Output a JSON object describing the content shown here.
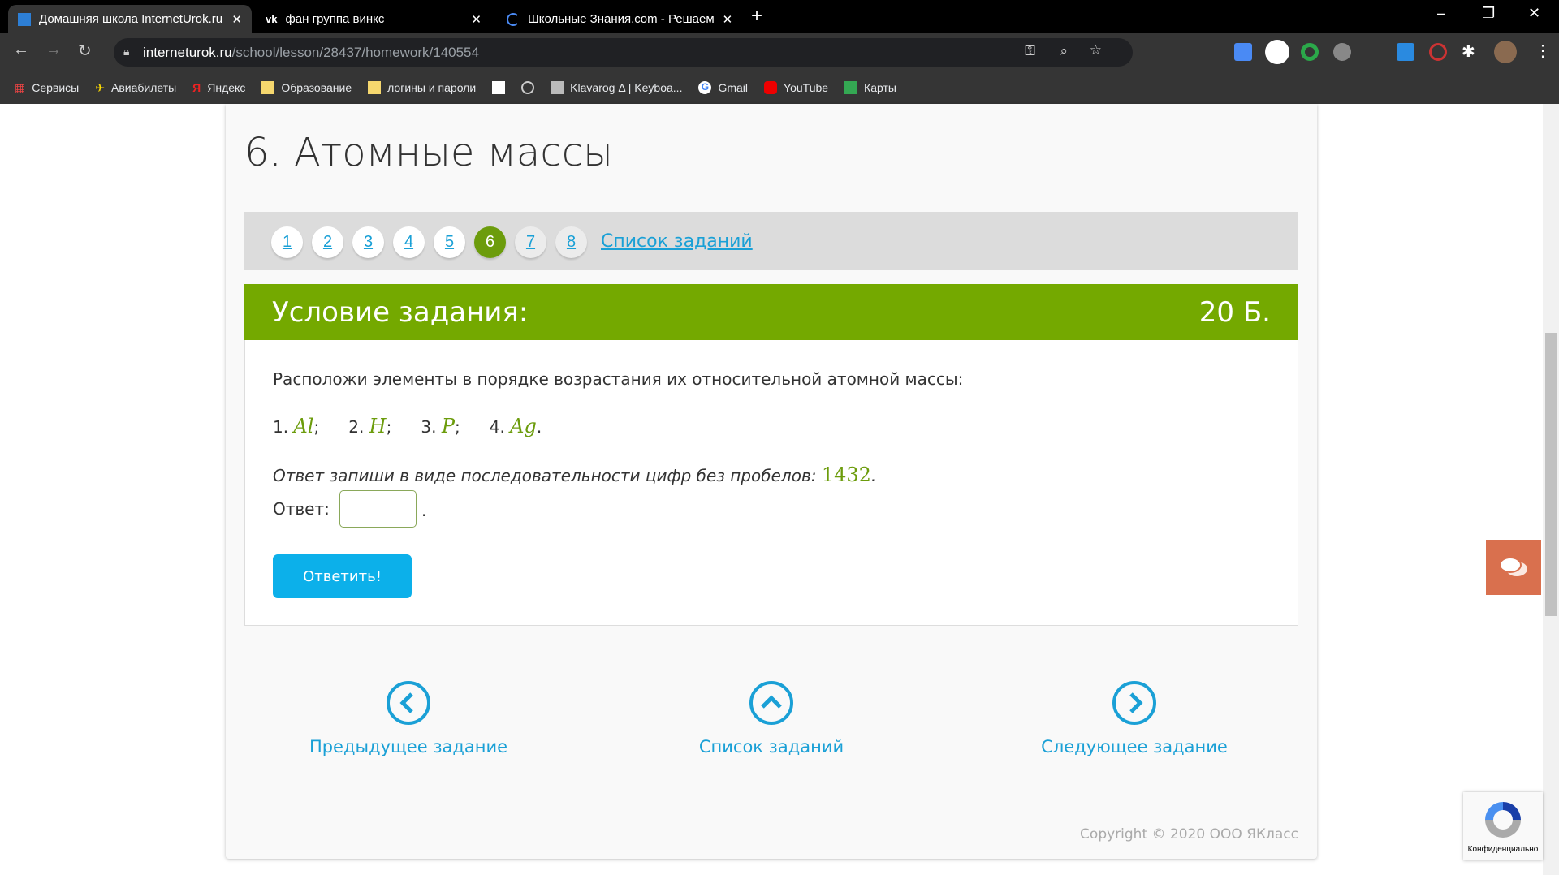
{
  "browser": {
    "tabs": [
      {
        "title": "Домашняя школа InternetUrok.ru"
      },
      {
        "title": "фан группа винкс"
      },
      {
        "title": "Школьные Знания.com - Решаем"
      }
    ],
    "url_host": "interneturok.ru",
    "url_path": "/school/lesson/28437/homework/140554",
    "bookmarks": [
      {
        "label": "Сервисы"
      },
      {
        "label": "Авиабилеты"
      },
      {
        "label": "Яндекс"
      },
      {
        "label": "Образование"
      },
      {
        "label": "логины и пароли"
      },
      {
        "label": "Klavarog Δ | Keyboa..."
      },
      {
        "label": "Gmail"
      },
      {
        "label": "YouTube"
      },
      {
        "label": "Карты"
      }
    ]
  },
  "page": {
    "title": "6. Атомные массы",
    "pager": {
      "items": [
        "1",
        "2",
        "3",
        "4",
        "5",
        "6",
        "7",
        "8"
      ],
      "current": "6",
      "task_list": "Список заданий"
    },
    "header": {
      "label": "Условие задания:",
      "points": "20 Б."
    },
    "task": {
      "prompt": "Расположи элементы в порядке возрастания их относительной атомной массы:",
      "elements": [
        {
          "num": "1.",
          "sym": "Al",
          "sep": ";"
        },
        {
          "num": "2.",
          "sym": "H",
          "sep": ";"
        },
        {
          "num": "3.",
          "sym": "P",
          "sep": ";"
        },
        {
          "num": "4.",
          "sym": "Ag",
          "sep": "."
        }
      ],
      "instruction": "Ответ запиши в виде последовательности цифр без пробелов:",
      "example": "1432",
      "answer_label": "Ответ:",
      "answer_value": "",
      "submit": "Ответить!"
    },
    "nav": {
      "prev": "Предыдущее задание",
      "list": "Список заданий",
      "next": "Следующее задание"
    },
    "copyright": "Copyright © 2020 ООО ЯКласс",
    "recaptcha_text": "Конфиденциально"
  },
  "colors": {
    "green": "#74a900",
    "blue": "#0cb0ea",
    "link": "#1aa0d6",
    "chat": "#d9704e"
  }
}
